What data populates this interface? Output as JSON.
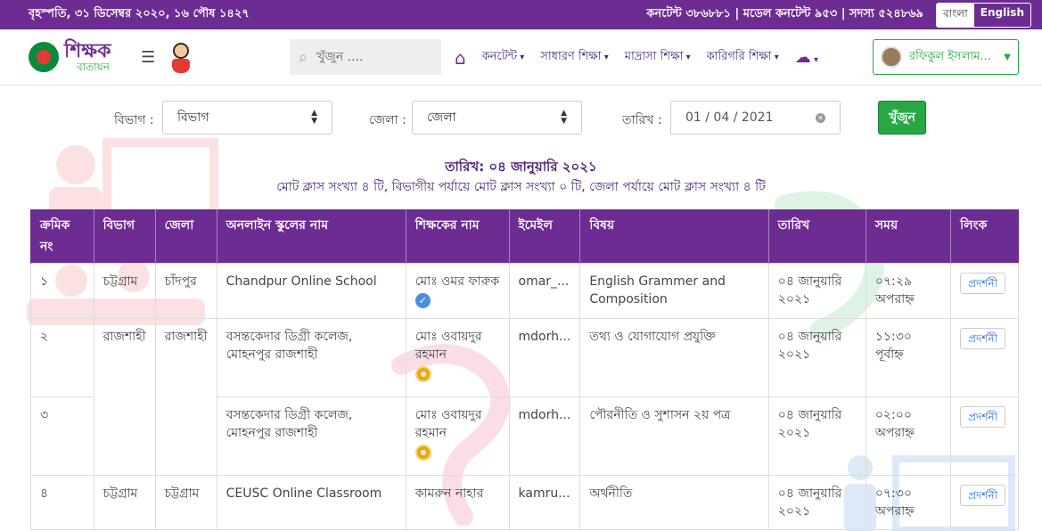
{
  "topbar": {
    "date": "বৃহস্পতি, ৩১ ডিসেম্বর ২০২০, ১৬ পৌষ ১৪২৭",
    "stats": "কনটেন্ট ৩৮৬৮৮১ | মডেল কনটেন্ট ৯৫৩ | সদস্য ৫২৪৮৬৯",
    "lang_bn": "বাংলা",
    "lang_en": "English"
  },
  "nav": {
    "logo_line1": "শিক্ষক",
    "logo_line2": "বাতায়ন",
    "search_placeholder": "খুঁজুন ....",
    "menu": [
      "কনটেন্ট",
      "সাধারণ শিক্ষা",
      "মাদ্রাসা শিক্ষা",
      "কারিগরি শিক্ষা"
    ],
    "user_name": "রফিকুল ইসলাম..."
  },
  "filters": {
    "division_label": "বিভাগ :",
    "division_value": "বিভাগ",
    "district_label": "জেলা :",
    "district_value": "জেলা",
    "date_label": "তারিখ :",
    "date_value": "01 / 04 / 2021",
    "search_button": "খুঁজুন"
  },
  "summary": {
    "date_line": "তারিখ: ০৪ জানুয়ারি ২০২১",
    "count_line": "মোট ক্লাস সংখ্যা ৪ টি, বিভাগীয় পর্যায়ে মোট ক্লাস সংখ্যা ০ টি, জেলা পর্যায়ে মোট ক্লাস সংখ্যা ৪ টি"
  },
  "table": {
    "headers": [
      "ক্রমিক নং",
      "বিভাগ",
      "জেলা",
      "অনলাইন স্কুলের নাম",
      "শিক্ষকের নাম",
      "ইমেইল",
      "বিষয়",
      "তারিখ",
      "সময়",
      "লিংক"
    ],
    "rows": [
      {
        "sl": "১",
        "division": "চট্টগ্রাম",
        "district": "চাঁদপুর",
        "school": "Chandpur Online School",
        "teacher": "মোঃ ওমর ফারুক",
        "badge": "verified",
        "email": "omar_...",
        "subject": "English Grammer and Composition",
        "date": "০৪ জানুয়ারি ২০২১",
        "time": "০৭:২৯ অপরাহ্ন",
        "link": "প্রদর্শনী"
      },
      {
        "sl": "২",
        "division": "রাজশাহী",
        "district": "রাজশাহী",
        "school": "বসন্তকেদার ডিগ্রী কলেজ, মোহনপুর রাজশাহী",
        "teacher": "মোঃ ওবায়দুর রহমান",
        "badge": "medal",
        "email": "mdorh...",
        "subject": "তথ্য ও যোগাযোগ প্রযুক্তি",
        "date": "০৪ জানুয়ারি ২০২১",
        "time": "১১:৩০ পূর্বাহ্ন",
        "link": "প্রদর্শনী"
      },
      {
        "sl": "৩",
        "division": "",
        "district": "",
        "school": "বসন্তকেদার ডিগ্রী কলেজ, মোহনপুর রাজশাহী",
        "teacher": "মোঃ ওবায়দুর রহমান",
        "badge": "medal",
        "email": "mdorh...",
        "subject": "পৌরনীতি ও সুশাসন ২য় পত্র",
        "date": "০৪ জানুয়ারি ২০২১",
        "time": "০২:০০ অপরাহ্ন",
        "link": "প্রদর্শনী"
      },
      {
        "sl": "৪",
        "division": "চট্টগ্রাম",
        "district": "চট্টগ্রাম",
        "school": "CEUSC Online Classroom",
        "teacher": "কামরুন নাহার",
        "badge": "",
        "email": "kamru...",
        "subject": "অর্থনীতি",
        "date": "০৪ জানুয়ারি ২০২১",
        "time": "০৭:৩০ অপরাহ্ন",
        "link": "প্রদর্শনী"
      }
    ]
  },
  "colors": {
    "brand": "#6c2c91",
    "accent": "#27a844",
    "link": "#2a6fd6"
  }
}
